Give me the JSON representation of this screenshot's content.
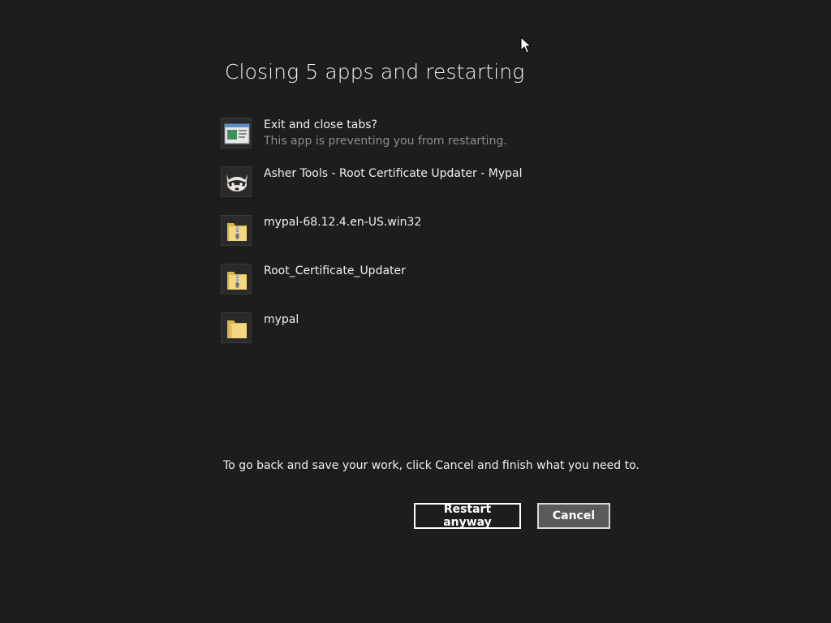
{
  "dialog": {
    "title": "Closing 5 apps and restarting",
    "apps": [
      {
        "name": "Exit and close tabs?",
        "subtitle": "This app is preventing you from restarting.",
        "icon": "browser-window-icon"
      },
      {
        "name": "Asher Tools - Root Certificate Updater - Mypal",
        "subtitle": "",
        "icon": "raccoon-icon"
      },
      {
        "name": "mypal-68.12.4.en-US.win32",
        "subtitle": "",
        "icon": "zip-folder-icon"
      },
      {
        "name": "Root_Certificate_Updater",
        "subtitle": "",
        "icon": "zip-folder-icon"
      },
      {
        "name": "mypal",
        "subtitle": "",
        "icon": "folder-icon"
      }
    ],
    "hint": "To go back and save your work, click Cancel and finish what you need to.",
    "restart_label": "Restart anyway",
    "cancel_label": "Cancel"
  },
  "colors": {
    "background": "#1d1d1d",
    "text": "#f0f0f0",
    "subtext": "#8e8e8e",
    "cancel_fill": "#5a5a5a"
  }
}
